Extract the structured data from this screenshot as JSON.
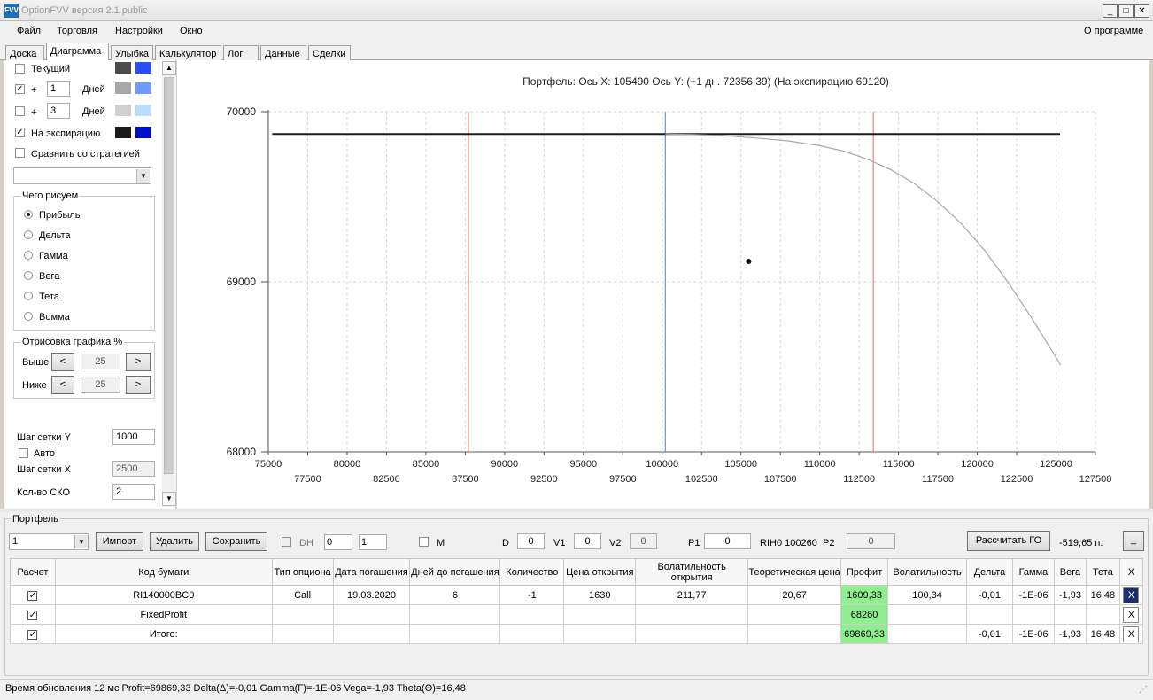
{
  "window": {
    "title": "OptionFVV версия 2.1 public",
    "icon_label": "FVV"
  },
  "menu": {
    "items": [
      "Файл",
      "Торговля",
      "Настройки",
      "Окно"
    ],
    "about": "О программе"
  },
  "tabs": [
    "Доска",
    "Диаграмма",
    "Улыбка",
    "Калькулятор",
    "Лог",
    "Данные",
    "Сделки"
  ],
  "active_tab": "Диаграмма",
  "left": {
    "current": {
      "label": "Текущий",
      "checked": false,
      "colors": [
        "#4d4d4d",
        "#2a4cff"
      ]
    },
    "days1": {
      "plus": "+",
      "value": "1",
      "unit": "Дней",
      "checked": true,
      "colors": [
        "#a8a8a8",
        "#6f9bff"
      ]
    },
    "days2": {
      "plus": "+",
      "value": "3",
      "unit": "Дней",
      "checked": false,
      "colors": [
        "#cfcfcf",
        "#b9ddff"
      ]
    },
    "expiry": {
      "label": "На экспирацию",
      "checked": true,
      "colors": [
        "#1c1c1c",
        "#0010c8"
      ]
    },
    "compare": {
      "label": "Сравнить со стратегией",
      "checked": false
    },
    "what_group": {
      "title": "Чего рисуем",
      "options": [
        "Прибыль",
        "Дельта",
        "Гамма",
        "Вега",
        "Тета",
        "Вомма"
      ],
      "selected": "Прибыль"
    },
    "draw_group": {
      "title": "Отрисовка графика %",
      "above_label": "Выше",
      "above_value": "25",
      "below_label": "Ниже",
      "below_value": "25",
      "dec": "<",
      "inc": ">"
    },
    "grid_y_label": "Шаг сетки Y",
    "grid_y_value": "1000",
    "auto_label": "Авто",
    "auto_checked": false,
    "grid_x_label": "Шаг сетки X",
    "grid_x_value": "2500",
    "sko_label": "Кол-во СКО",
    "sko_value": "2"
  },
  "chart_data": {
    "type": "line",
    "title": "Портфель:  Ось X:  105490 Ось Y:   (+1 дн.  72356,39)   (На экспирацию  69120)",
    "xlim": [
      75000,
      127500
    ],
    "ylim": [
      68000,
      70000
    ],
    "x_ticks_top": [
      "75000",
      "80000",
      "85000",
      "90000",
      "95000",
      "100000",
      "105000",
      "110000",
      "115000",
      "120000",
      "125000"
    ],
    "x_ticks_bottom": [
      "77500",
      "82500",
      "87500",
      "92500",
      "97500",
      "102500",
      "107500",
      "112500",
      "117500",
      "122500",
      "127500"
    ],
    "y_ticks": [
      "70000",
      "69000",
      "68000"
    ],
    "grid": true,
    "series": [
      {
        "color": "#1c1c1c",
        "x": [
          75250,
          125250
        ],
        "y": [
          69869,
          69869
        ]
      },
      {
        "color": "#a8a8a8",
        "x": [
          100200,
          102000,
          104000,
          106000,
          108000,
          110000,
          111500,
          113000,
          114500,
          116000,
          117500,
          119000,
          120500,
          122000,
          123500,
          125300
        ],
        "y": [
          69869,
          69865,
          69858,
          69845,
          69828,
          69800,
          69768,
          69722,
          69660,
          69578,
          69470,
          69340,
          69180,
          68990,
          68780,
          68510
        ]
      }
    ],
    "vlines": [
      {
        "x": 87700,
        "color": "#f08080"
      },
      {
        "x": 100200,
        "color": "#7a8fb5"
      },
      {
        "x": 113400,
        "color": "#f08080"
      }
    ],
    "point": {
      "x": 105490,
      "y": 69120
    }
  },
  "portfolio": {
    "title": "Портфель",
    "select_value": "1",
    "import_label": "Импорт",
    "delete_label": "Удалить",
    "save_label": "Сохранить",
    "dh_label": "DH",
    "dh_val1": "0",
    "dh_val2": "1",
    "m_label": "M",
    "d_label": "D",
    "d_value": "0",
    "v1_label": "V1",
    "v1_value": "0",
    "v2_label": "V2",
    "v2_value": "0",
    "p1_label": "P1",
    "p1_value": "0",
    "ticker_text": "RIH0 100260",
    "p2_label": "P2",
    "p2_value": "0",
    "calc_go_label": "Рассчитать ГО",
    "go_value": "-519,65 п.",
    "minimize_label": "_",
    "columns": [
      "Расчет",
      "Код бумаги",
      "Тип опциона",
      "Дата погашения",
      "Дней до погашения",
      "Количество",
      "Цена открытия",
      "Волатильность открытия",
      "Теоретическая цена",
      "Профит",
      "Волатильность",
      "Дельта",
      "Гамма",
      "Вега",
      "Тета",
      "X"
    ],
    "rows": [
      {
        "checked": true,
        "code": "RI140000BC0",
        "type": "Call",
        "date": "19.03.2020",
        "days": "6",
        "qty": "-1",
        "open_price": "1630",
        "open_vol": "211,77",
        "theor": "20,67",
        "profit": "1609,33",
        "vol": "100,34",
        "delta": "-0,01",
        "gamma": "-1E-06",
        "vega": "-1,93",
        "theta": "16,48",
        "x": "X"
      },
      {
        "checked": true,
        "code": "FixedProfit",
        "type": "",
        "date": "",
        "days": "",
        "qty": "",
        "open_price": "",
        "open_vol": "",
        "theor": "",
        "profit": "68260",
        "vol": "",
        "delta": "",
        "gamma": "",
        "vega": "",
        "theta": "",
        "x": "X"
      },
      {
        "checked": true,
        "code": "Итого:",
        "type": "",
        "date": "",
        "days": "",
        "qty": "",
        "open_price": "",
        "open_vol": "",
        "theor": "",
        "profit": "69869,33",
        "vol": "",
        "delta": "-0,01",
        "gamma": "-1E-06",
        "vega": "-1,93",
        "theta": "16,48",
        "x": "X"
      }
    ]
  },
  "status": "Время обновления 12 мс   Profit=69869,33 Delta(Δ)=-0,01 Gamma(Γ)=-1E-06 Vega=-1,93 Theta(Θ)=16,48"
}
